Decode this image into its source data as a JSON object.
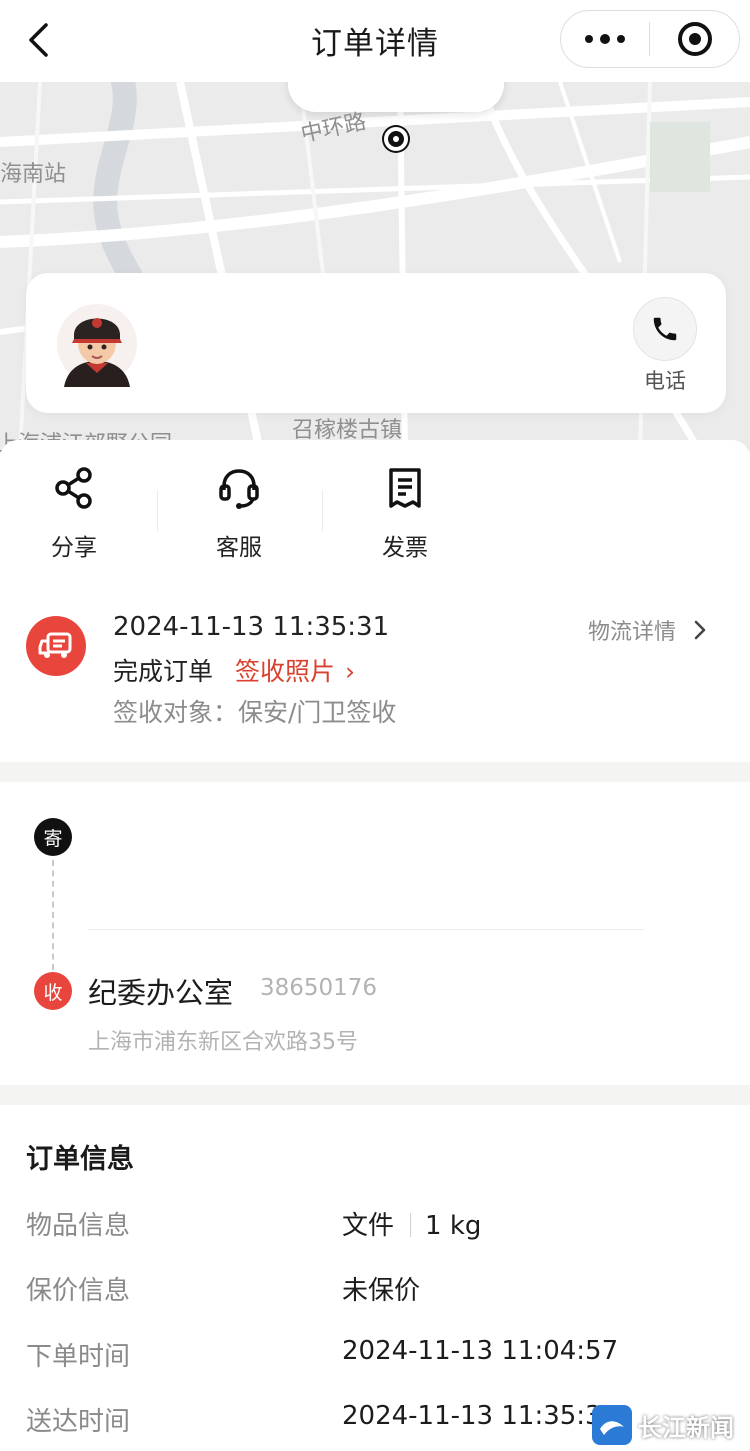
{
  "nav": {
    "title": "订单详情"
  },
  "map": {
    "labels": [
      "中环路",
      "海南站",
      "召稼楼古镇",
      "上海浦江郊野公园"
    ]
  },
  "courier": {
    "phone_label": "电话"
  },
  "actions": [
    {
      "label": "分享",
      "icon": "share-icon"
    },
    {
      "label": "客服",
      "icon": "headset-icon"
    },
    {
      "label": "发票",
      "icon": "invoice-icon"
    }
  ],
  "status": {
    "time": "2024-11-13 11:35:31",
    "state": "完成订单",
    "photo_link": "签收照片",
    "signer": "签收对象：保安/门卫签收",
    "logistics_link": "物流详情",
    "accent": "#e8453c"
  },
  "route": {
    "sender_tag": "寄",
    "receiver_tag": "收",
    "receiver_name": "纪委办公室",
    "receiver_phone": "38650176",
    "receiver_address": "上海市浦东新区合欢路35号"
  },
  "order_info": {
    "title": "订单信息",
    "rows": [
      {
        "label": "物品信息",
        "value": "文件",
        "value2": "1 kg"
      },
      {
        "label": "保价信息",
        "value": "未保价"
      },
      {
        "label": "下单时间",
        "value": "2024-11-13 11:04:57"
      },
      {
        "label": "送达时间",
        "value": "2024-11-13 11:35:31"
      }
    ]
  },
  "watermark": {
    "text": "长江新闻"
  }
}
